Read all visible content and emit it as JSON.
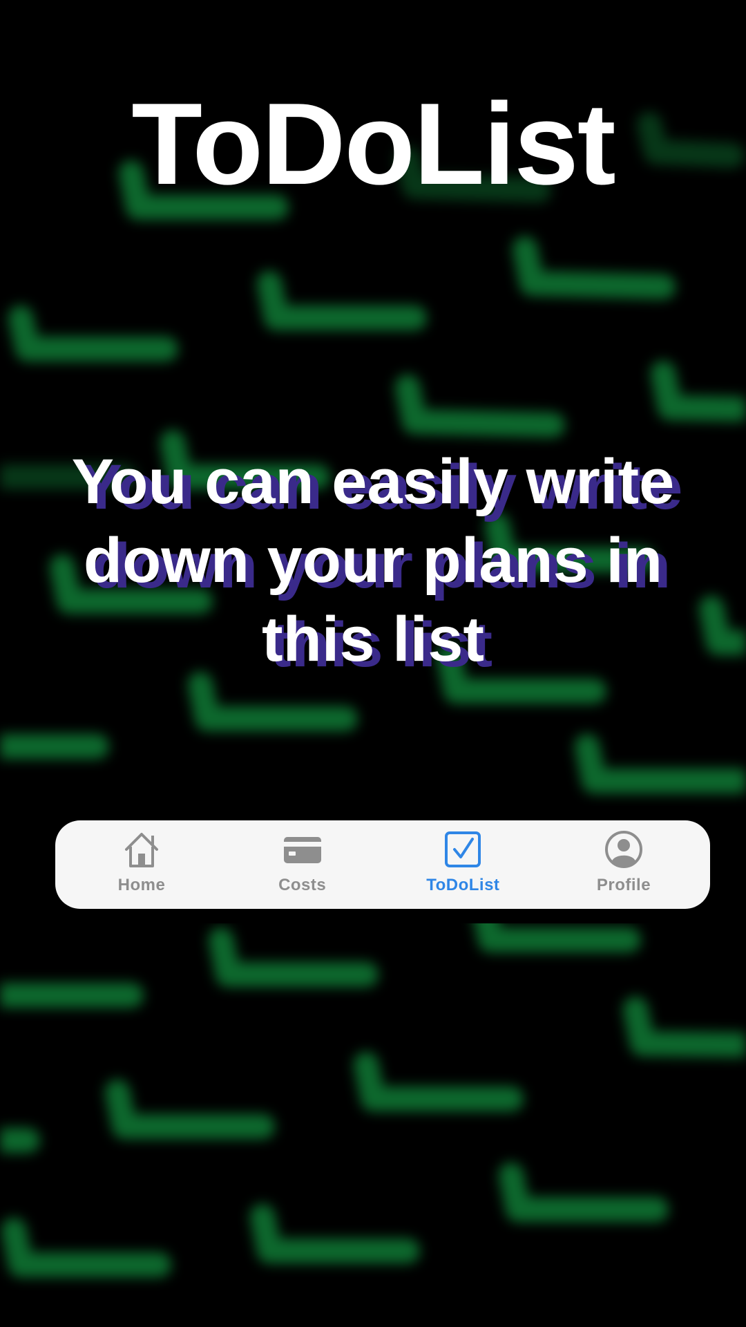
{
  "app_title": "ToDoList",
  "tagline": "You can easily write down your plans in this list",
  "colors": {
    "background": "#000000",
    "pattern_green": "#0f7a35",
    "text_shadow_purple": "#3a2a8a",
    "tab_active": "#2f86e6",
    "tab_inactive": "#8e8e8e",
    "tabbar_background": "#f6f6f6"
  },
  "tabbar": {
    "active": "todolist",
    "tabs": [
      {
        "id": "home",
        "label": "Home",
        "icon": "house-icon"
      },
      {
        "id": "costs",
        "label": "Costs",
        "icon": "credit-card-icon"
      },
      {
        "id": "todolist",
        "label": "ToDoList",
        "icon": "checkbox-icon"
      },
      {
        "id": "profile",
        "label": "Profile",
        "icon": "person-circle-icon"
      }
    ]
  }
}
